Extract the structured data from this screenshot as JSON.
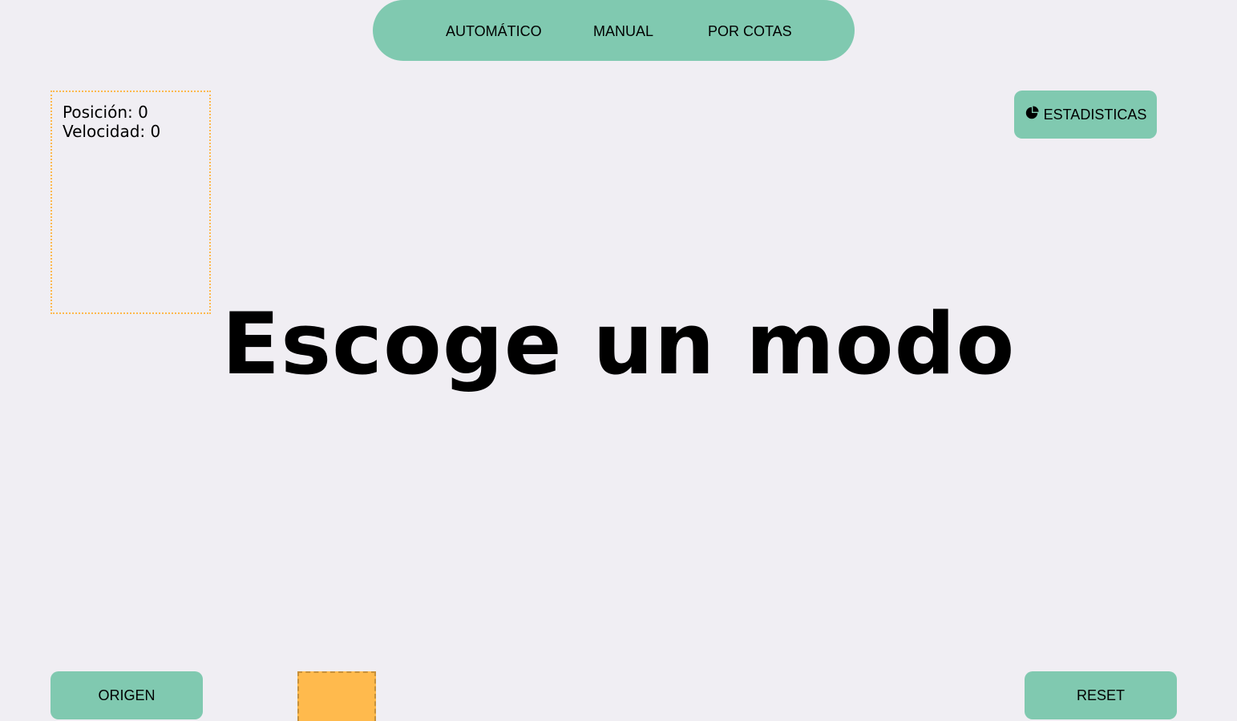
{
  "mode_bar": {
    "automatic_label": "AUTOMÁTICO",
    "manual_label": "MANUAL",
    "cotas_label": "POR COTAS"
  },
  "info_panel": {
    "position_label": "Posición:",
    "position_value": "0",
    "velocity_label": "Velocidad:",
    "velocity_value": "0"
  },
  "stats_button": {
    "label": "ESTADISTICAS",
    "icon": "pie-chart-icon"
  },
  "headline": "Escoge un modo",
  "bottom": {
    "origin_label": "ORIGEN",
    "reset_label": "RESET"
  },
  "colors": {
    "background": "#f0eef3",
    "accent_green": "#80c9b0",
    "cart_orange": "#ffba4d",
    "panel_border": "#ffb84d"
  }
}
